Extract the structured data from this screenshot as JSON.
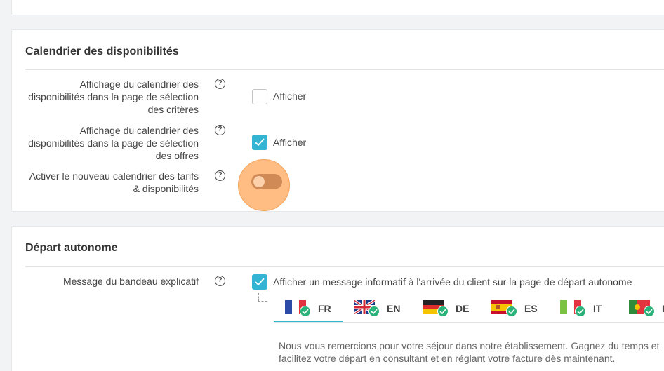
{
  "calendar_section": {
    "title": "Calendrier des disponibilités",
    "rows": [
      {
        "label": "Affichage du calendrier des disponibilités dans la page de sélection des critères",
        "checkbox_label": "Afficher",
        "checked": false
      },
      {
        "label": "Affichage du calendrier des disponibilités dans la page de sélection des offres",
        "checkbox_label": "Afficher",
        "checked": true
      },
      {
        "label": "Activer le nouveau calendrier des tarifs & disponibilités",
        "toggle_on": false
      }
    ]
  },
  "departure_section": {
    "title": "Départ autonome",
    "banner_label": "Message du bandeau explicatif",
    "banner_checkbox_label": "Afficher un message informatif à l'arrivée du client sur la page de départ autonome",
    "banner_checked": true,
    "languages": [
      {
        "code": "FR",
        "flag": "france-flag-icon",
        "active": true
      },
      {
        "code": "EN",
        "flag": "uk-flag-icon",
        "active": false
      },
      {
        "code": "DE",
        "flag": "germany-flag-icon",
        "active": false
      },
      {
        "code": "ES",
        "flag": "spain-flag-icon",
        "active": false
      },
      {
        "code": "IT",
        "flag": "italy-flag-icon",
        "active": false
      },
      {
        "code": "PT",
        "flag": "portugal-flag-icon",
        "active": false
      }
    ],
    "message": "Nous vous remercions pour votre séjour dans notre établissement. Gagnez du temps et facilitez votre départ en consultant et en réglant votre facture dès maintenant."
  },
  "colors": {
    "accent": "#32b4d2",
    "toggle_highlight": "#ffbd84",
    "success": "#2bb27a"
  },
  "help_glyph": "?"
}
